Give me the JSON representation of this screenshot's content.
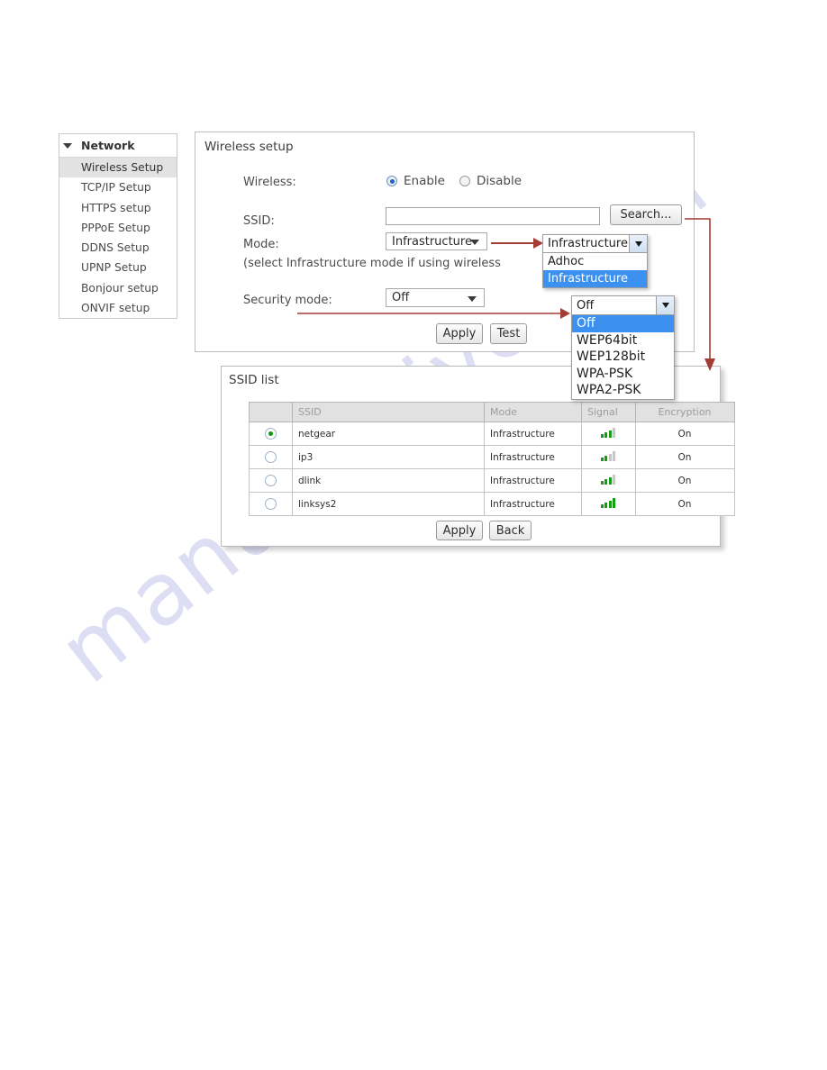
{
  "watermark": {
    "text": "manualshive.com"
  },
  "sidebar": {
    "header": "Network",
    "items": [
      {
        "label": "Wireless Setup",
        "active": true
      },
      {
        "label": "TCP/IP Setup",
        "active": false
      },
      {
        "label": "HTTPS setup",
        "active": false
      },
      {
        "label": "PPPoE Setup",
        "active": false
      },
      {
        "label": "DDNS Setup",
        "active": false
      },
      {
        "label": "UPNP Setup",
        "active": false
      },
      {
        "label": "Bonjour setup",
        "active": false
      },
      {
        "label": "ONVIF setup",
        "active": false
      }
    ]
  },
  "wireless_panel": {
    "title": "Wireless setup",
    "wireless_label": "Wireless:",
    "radio_enable": "Enable",
    "radio_disable": "Disable",
    "selected_radio": "Enable",
    "ssid_label": "SSID:",
    "ssid_value": "",
    "ssid_placeholder": "",
    "search_button": "Search...",
    "mode_label": "Mode:",
    "mode_value": "Infrastructure",
    "hint_text": "(select Infrastructure mode if using wireless",
    "security_label": "Security mode:",
    "security_value": "Off",
    "apply_button": "Apply",
    "test_button": "Test"
  },
  "mode_dropdown": {
    "selected": "Infrastructure",
    "options": [
      {
        "label": "Adhoc",
        "highlighted": false
      },
      {
        "label": "Infrastructure",
        "highlighted": true
      }
    ]
  },
  "security_dropdown": {
    "selected": "Off",
    "options": [
      {
        "label": "Off",
        "highlighted": true
      },
      {
        "label": "WEP64bit",
        "highlighted": false
      },
      {
        "label": "WEP128bit",
        "highlighted": false
      },
      {
        "label": "WPA-PSK",
        "highlighted": false
      },
      {
        "label": "WPA2-PSK",
        "highlighted": false
      }
    ]
  },
  "ssid_panel": {
    "title": "SSID list",
    "columns": [
      "",
      "SSID",
      "Mode",
      "Signal",
      "Encryption"
    ],
    "rows": [
      {
        "selected": true,
        "ssid": "netgear",
        "mode": "Infrastructure",
        "signal": 3,
        "encryption": "On"
      },
      {
        "selected": false,
        "ssid": "ip3",
        "mode": "Infrastructure",
        "signal": 2,
        "encryption": "On"
      },
      {
        "selected": false,
        "ssid": "dlink",
        "mode": "Infrastructure",
        "signal": 3,
        "encryption": "On"
      },
      {
        "selected": false,
        "ssid": "linksys2",
        "mode": "Infrastructure",
        "signal": 4,
        "encryption": "On"
      }
    ],
    "apply_button": "Apply",
    "back_button": "Back"
  },
  "colors": {
    "arrow_red": "#a33c35",
    "highlight_blue": "#3c91f0",
    "signal_green": "#12a012",
    "radio_blue": "#1b66c9",
    "radio_green": "#119511"
  }
}
